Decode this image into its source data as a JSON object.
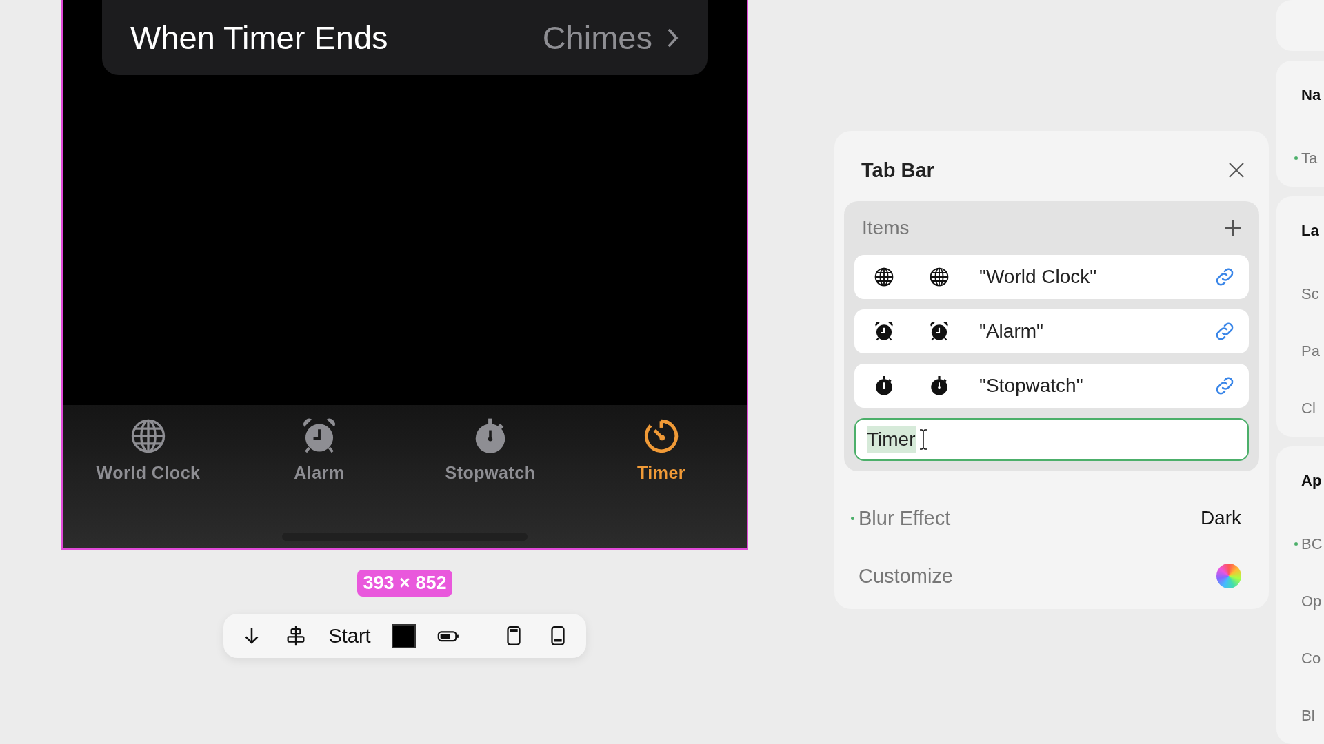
{
  "phone": {
    "settings_row": {
      "label": "When Timer Ends",
      "value": "Chimes"
    },
    "tab_bar": {
      "items": [
        {
          "label": "World Clock",
          "kind": "globe",
          "selected": false
        },
        {
          "label": "Alarm",
          "kind": "alarm",
          "selected": false
        },
        {
          "label": "Stopwatch",
          "kind": "stopwatch",
          "selected": false
        },
        {
          "label": "Timer",
          "kind": "timer",
          "selected": true
        }
      ]
    }
  },
  "size_badge": "393 × 852",
  "toolbar": {
    "items": [
      {
        "kind": "arrow-down"
      },
      {
        "kind": "align-center"
      },
      {
        "kind": "text",
        "label": "Start"
      },
      {
        "kind": "swatch",
        "color": "#000000"
      },
      {
        "kind": "battery"
      },
      {
        "kind": "divider"
      },
      {
        "kind": "phone-top"
      },
      {
        "kind": "phone-bottom"
      }
    ]
  },
  "inspector": {
    "title": "Tab Bar",
    "items_section": {
      "title": "Items",
      "rows": [
        {
          "kind": "globe",
          "label": "\"World Clock\""
        },
        {
          "kind": "alarm",
          "label": "\"Alarm\""
        },
        {
          "kind": "stopwatch",
          "label": "\"Stopwatch\""
        }
      ],
      "field": {
        "value": "Timer",
        "text_selected": true
      }
    },
    "properties": [
      {
        "kind": "value",
        "label": "Blur Effect",
        "modified": true,
        "value": "Dark"
      },
      {
        "kind": "color-wheel",
        "label": "Customize",
        "modified": false
      }
    ]
  },
  "side_panel": {
    "sections": [
      {
        "title": "Na",
        "rows": [
          {
            "label": "Ta",
            "modified": true
          }
        ]
      },
      {
        "title": "La",
        "rows": [
          {
            "label": "Sc",
            "modified": false
          },
          {
            "label": "Pa",
            "modified": false
          },
          {
            "label": "Cl",
            "modified": false
          }
        ]
      },
      {
        "title": "Ap",
        "rows": [
          {
            "label": "BC",
            "modified": true
          },
          {
            "label": "Op",
            "modified": false
          },
          {
            "label": "Co",
            "modified": false
          },
          {
            "label": "Bl",
            "modified": false
          }
        ]
      }
    ]
  }
}
